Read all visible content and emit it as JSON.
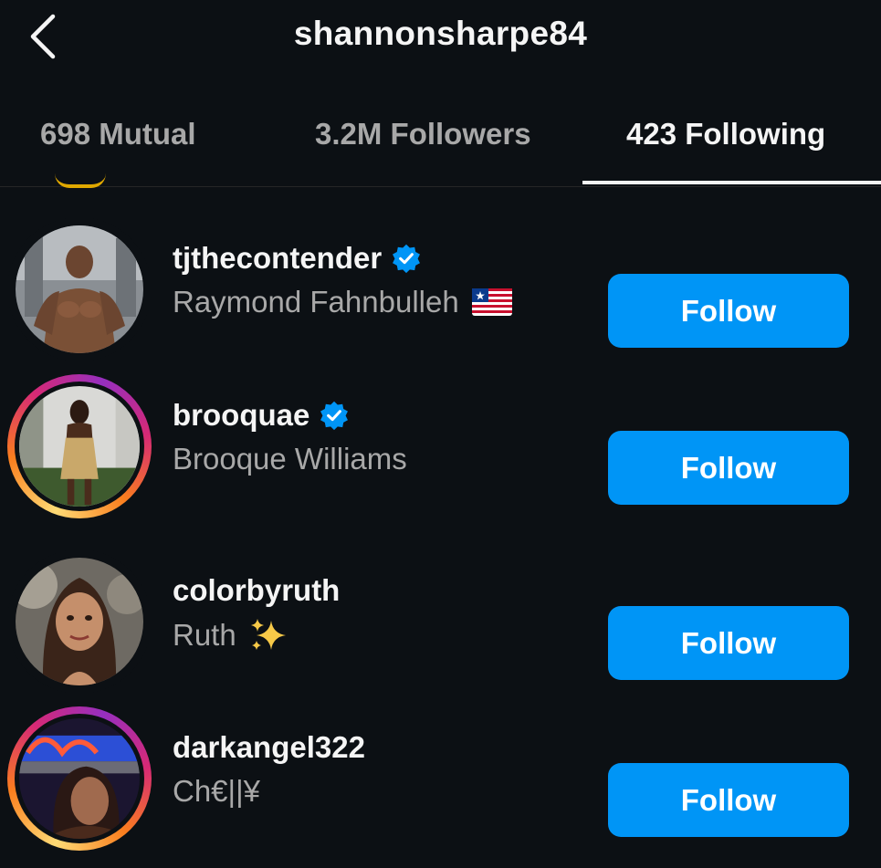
{
  "header": {
    "title": "shannonsharpe84",
    "back_icon": "chevron-left-icon"
  },
  "tabs": [
    {
      "label": "698 Mutual",
      "active": false
    },
    {
      "label": "3.2M Followers",
      "active": false
    },
    {
      "label": "423 Following",
      "active": true
    }
  ],
  "users": [
    {
      "username": "tjthecontender",
      "verified": true,
      "full_name": "Raymond Fahnbulleh",
      "emoji": "liberia-flag",
      "story": false,
      "button": "Follow"
    },
    {
      "username": "brooquae",
      "verified": true,
      "full_name": "Brooque Williams",
      "emoji": "",
      "story": true,
      "button": "Follow"
    },
    {
      "username": "colorbyruth",
      "verified": false,
      "full_name": "Ruth",
      "emoji": "sparkles",
      "story": false,
      "button": "Follow"
    },
    {
      "username": "darkangel322",
      "verified": false,
      "full_name": "Ch€||¥",
      "emoji": "",
      "story": true,
      "button": "Follow"
    }
  ],
  "colors": {
    "background": "#0c1014",
    "primary_button": "#0095f6",
    "verified_badge": "#0095f6",
    "secondary_text": "#a8a8a8"
  }
}
